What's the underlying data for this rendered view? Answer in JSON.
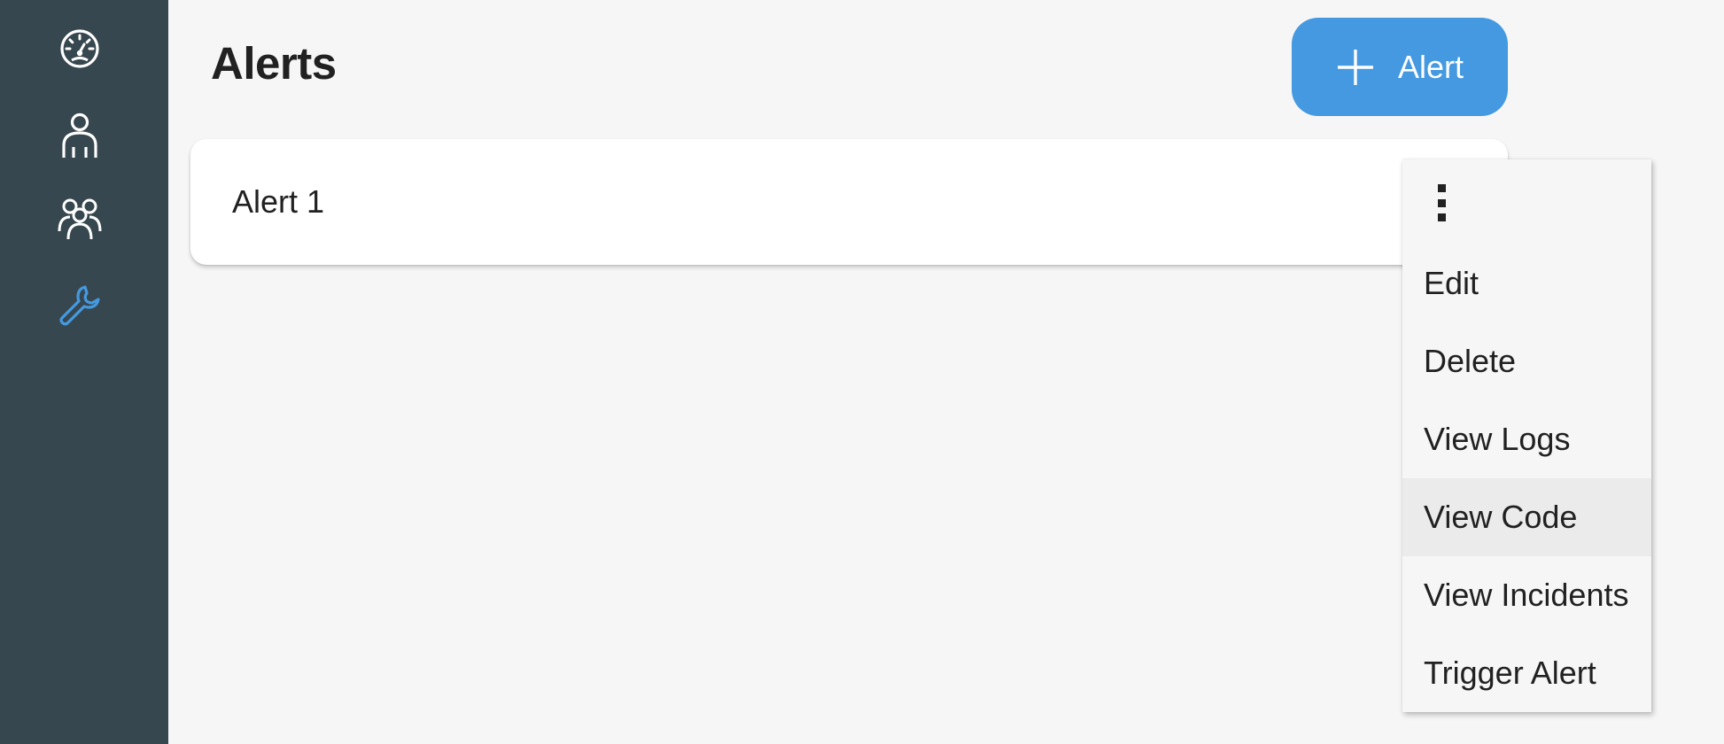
{
  "sidebar": {
    "items": [
      {
        "name": "dashboard",
        "icon": "speedometer-icon",
        "active": false
      },
      {
        "name": "users",
        "icon": "user-icon",
        "active": false
      },
      {
        "name": "groups",
        "icon": "users-group-icon",
        "active": false
      },
      {
        "name": "tools",
        "icon": "wrench-icon",
        "active": true
      }
    ]
  },
  "colors": {
    "sidebar_bg": "#37474f",
    "accent": "#4599e0",
    "page_bg": "#f6f6f6",
    "icon_default": "#ffffff",
    "icon_active": "#4599e0"
  },
  "header": {
    "title": "Alerts",
    "add_button_label": "Alert",
    "add_button_icon": "plus-icon"
  },
  "alerts": [
    {
      "name": "Alert 1"
    }
  ],
  "menu": {
    "trigger_icon": "kebab-menu-icon",
    "items": [
      {
        "label": "Edit"
      },
      {
        "label": "Delete"
      },
      {
        "label": "View Logs"
      },
      {
        "label": "View Code",
        "highlighted": true
      },
      {
        "label": "View Incidents"
      },
      {
        "label": "Trigger Alert"
      }
    ]
  }
}
